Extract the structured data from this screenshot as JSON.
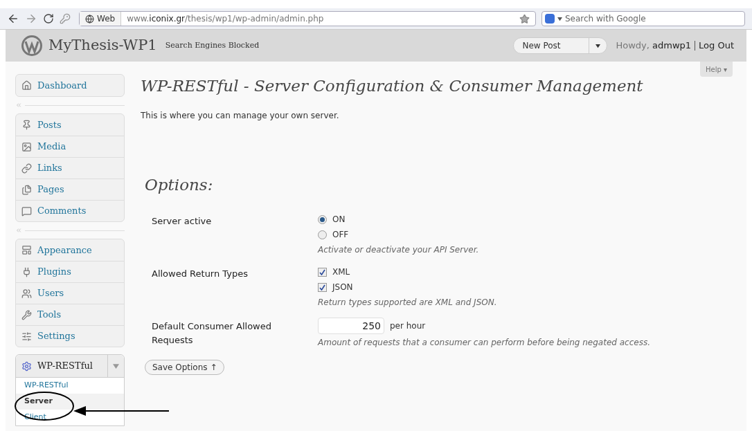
{
  "browser": {
    "site_label": "Web",
    "url": "www.**iconix.gr**/thesis/wp1/wp-admin/admin.php",
    "search": {
      "placeholder": "Search with Google"
    }
  },
  "header": {
    "site_title": "MyThesis-WP1",
    "notice": "Search Engines Blocked",
    "new_post": "New Post",
    "greeting": "Howdy, **admwp1**",
    "logout": "Log Out"
  },
  "help": "Help ▾",
  "sidebar": {
    "groups": [
      {
        "items": [
          {
            "label": "Dashboard",
            "selected": false
          }
        ]
      },
      {
        "items": [
          {
            "label": "Posts",
            "selected": false
          },
          {
            "label": "Media",
            "selected": false
          },
          {
            "label": "Links",
            "selected": false
          },
          {
            "label": "Pages",
            "selected": false
          },
          {
            "label": "Comments",
            "selected": false
          }
        ]
      },
      {
        "items": [
          {
            "label": "Appearance",
            "selected": false
          },
          {
            "label": "Plugins",
            "selected": false
          },
          {
            "label": "Users",
            "selected": false
          },
          {
            "label": "Tools",
            "selected": false
          },
          {
            "label": "Settings",
            "selected": false
          }
        ]
      }
    ],
    "plugin_menu": {
      "label": "WP-RESTful",
      "expanded": true,
      "submenu": [
        {
          "label": "WP-RESTful",
          "selected": false
        },
        {
          "label": "Server",
          "selected": true
        },
        {
          "label": "Client",
          "selected": false
        }
      ]
    }
  },
  "page": {
    "title": "WP-RESTful - Server Configuration & Consumer Management",
    "intro": "This is where you can manage your own server.",
    "section": "Options:",
    "fields": [
      {
        "kind": "radio",
        "label": "Server active",
        "options": [
          {
            "label": "ON",
            "selected": true
          },
          {
            "label": "OFF",
            "selected": false
          }
        ],
        "hint": "Activate or deactivate your API Server."
      },
      {
        "kind": "checkbox",
        "label": "Allowed Return Types",
        "options": [
          {
            "label": "XML",
            "checked": true
          },
          {
            "label": "JSON",
            "checked": true
          }
        ],
        "hint": "Return types supported are XML and JSON."
      },
      {
        "kind": "number",
        "label": "Default Consumer Allowed Requests",
        "value": "250",
        "unit": "per hour",
        "hint": "Amount of requests that a consumer can perform before being negated access."
      }
    ],
    "save": "Save Options ↑"
  }
}
